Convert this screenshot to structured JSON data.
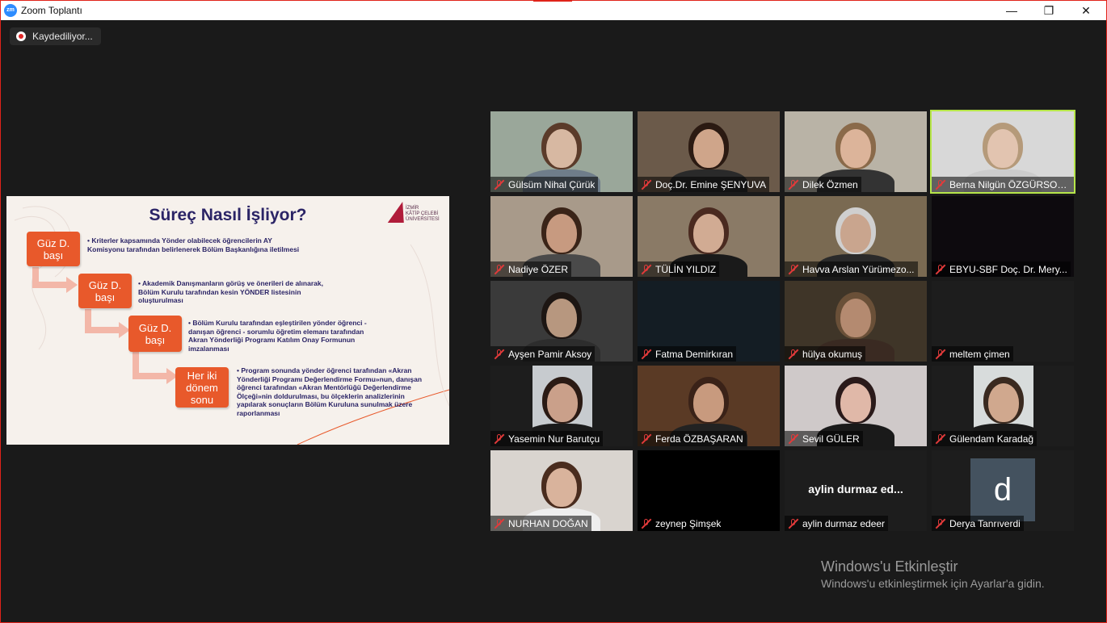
{
  "window": {
    "title": "Zoom Toplantı",
    "app_icon": "zm",
    "min_icon": "—",
    "max_icon": "❐",
    "close_icon": "✕"
  },
  "recording": {
    "label": "Kaydediliyor..."
  },
  "slide": {
    "title": "Süreç Nasıl İşliyor?",
    "logo_text": [
      "İZMİR",
      "KÂTİP ÇELEBİ",
      "ÜNİVERSİTESİ"
    ],
    "steps": [
      {
        "label_1": "Güz D.",
        "label_2": "başı",
        "text": "Kriterler kapsamında Yönder olabilecek öğrencilerin AY Komisyonu tarafından belirlenerek Bölüm Başkanlığına iletilmesi"
      },
      {
        "label_1": "Güz D.",
        "label_2": "başı",
        "text": "Akademik Danışmanların görüş ve önerileri de alınarak, Bölüm Kurulu tarafından kesin YÖNDER listesinin oluşturulması"
      },
      {
        "label_1": "Güz D.",
        "label_2": "başı",
        "text": "Bölüm Kurulu tarafından eşleştirilen yönder öğrenci - danışan öğrenci - sorumlu öğretim elemanı tarafından Akran Yönderliği Programı Katılım Onay Formunun imzalanması"
      },
      {
        "label_1": "Her iki",
        "label_2": "dönem",
        "label_3": "sonu",
        "text": "Program sonunda yönder öğrenci tarafından «Akran Yönderliği Programı Değerlendirme Formu»nun, danışan öğrenci tarafından «Akran Mentörlüğü Değerlendirme Ölçeği»nin doldurulması, bu ölçeklerin analizlerinin yapılarak sonuçların Bölüm Kuruluna sunulmak üzere raporlanması"
      }
    ]
  },
  "participants": [
    {
      "name": "Gülsüm Nihal Çürük",
      "bg": "#9aa79a"
    },
    {
      "name": "Doç.Dr. Emine ŞENYUVA",
      "bg": "#6b5a4a"
    },
    {
      "name": "Dilek Özmen",
      "bg": "#b9b3a6"
    },
    {
      "name": "Berna Nilgün ÖZGÜRSOY U...",
      "bg": "#d8d8d8"
    },
    {
      "name": "Nadiye ÖZER",
      "bg": "#a89a8a"
    },
    {
      "name": "TÜLİN YILDIZ",
      "bg": "#8a7a66"
    },
    {
      "name": "Havva Arslan Yürümezo...",
      "bg": "#7a6a52"
    },
    {
      "name": "EBYU-SBF Doç. Dr. Mery...",
      "bg": "#0d0a0e"
    },
    {
      "name": "Ayşen Pamir Aksoy",
      "bg": "#3a3a3a"
    },
    {
      "name": "Fatma Demirkıran",
      "bg": "#141d24"
    },
    {
      "name": "hülya okumuş",
      "bg": "#3f3528"
    },
    {
      "name": "meltem çimen",
      "bg": "#1d1d1d"
    },
    {
      "name": "Yasemin Nur Barutçu",
      "bg": "#1d1d1d"
    },
    {
      "name": "Ferda ÖZBAŞARAN",
      "bg": "#5a3a25"
    },
    {
      "name": "Sevil GÜLER",
      "bg": "#cfc9c9"
    },
    {
      "name": "Gülendam Karadağ",
      "bg": "#1d1d1d"
    },
    {
      "name": "NURHAN DOĞAN",
      "bg": "#d9d4cf"
    },
    {
      "name": "zeynep Şimşek",
      "bg": "#000000"
    },
    {
      "name": "aylin durmaz edeer",
      "bg": "#1d1d1d",
      "display_name": "aylin durmaz ed..."
    },
    {
      "name": "Derya Tanrıverdi",
      "bg": "#1d1d1d",
      "avatar_letter": "d"
    }
  ],
  "windows_activation": {
    "title": "Windows'u Etkinleştir",
    "subtitle": "Windows'u etkinleştirmek için Ayarlar'a gidin."
  }
}
